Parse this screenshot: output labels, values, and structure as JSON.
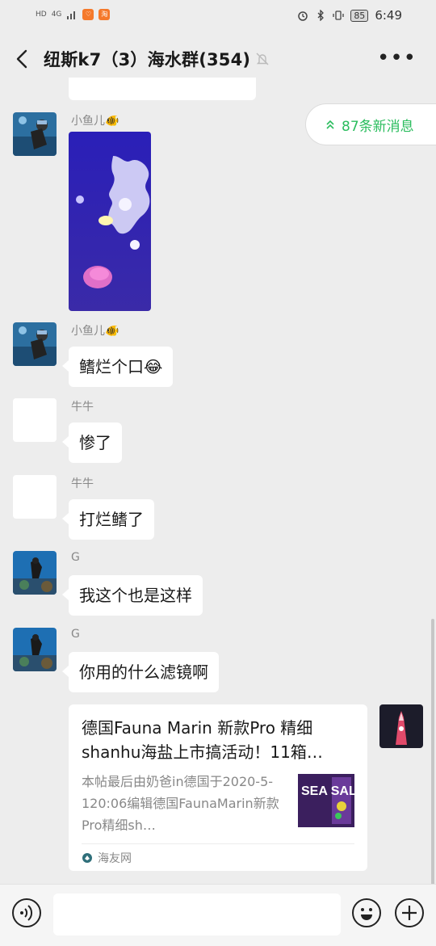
{
  "status_bar": {
    "left_badges": [
      "HD",
      "4G"
    ],
    "battery": "85",
    "time": "6:49"
  },
  "header": {
    "title": "纽斯k7（3）海水群(354)",
    "back_icon": "chevron-left-icon",
    "mute_icon": "bell-off-icon",
    "more_icon": "more-dots-icon"
  },
  "new_messages": {
    "label": "87条新消息",
    "icon": "double-chevron-up-icon"
  },
  "messages": [
    {
      "sender": "小鱼儿🐠",
      "type": "image"
    },
    {
      "sender": "小鱼儿🐠",
      "text": "鳍烂个口😂"
    },
    {
      "sender": "牛牛",
      "text": "惨了"
    },
    {
      "sender": "牛牛",
      "text": "打烂鳍了"
    },
    {
      "sender": "G",
      "text": "我这个也是这样"
    },
    {
      "sender": "G",
      "text": "你用的什么滤镜啊"
    }
  ],
  "link_card": {
    "title": "德国Fauna Marin 新款Pro 精细shanhu海盐上市搞活动！11箱…",
    "description": "本帖最后由奶爸in德国于2020-5-120:06编辑德国FaunaMarin新款Pro精细sh…",
    "source": "海友网",
    "thumb_text": "SEA SALT"
  },
  "input_bar": {
    "voice_icon": "voice-icon",
    "emoji_icon": "emoji-icon",
    "plus_icon": "plus-icon"
  },
  "colors": {
    "accent": "#2bbd5e",
    "background": "#ededed",
    "bubble": "#ffffff"
  }
}
